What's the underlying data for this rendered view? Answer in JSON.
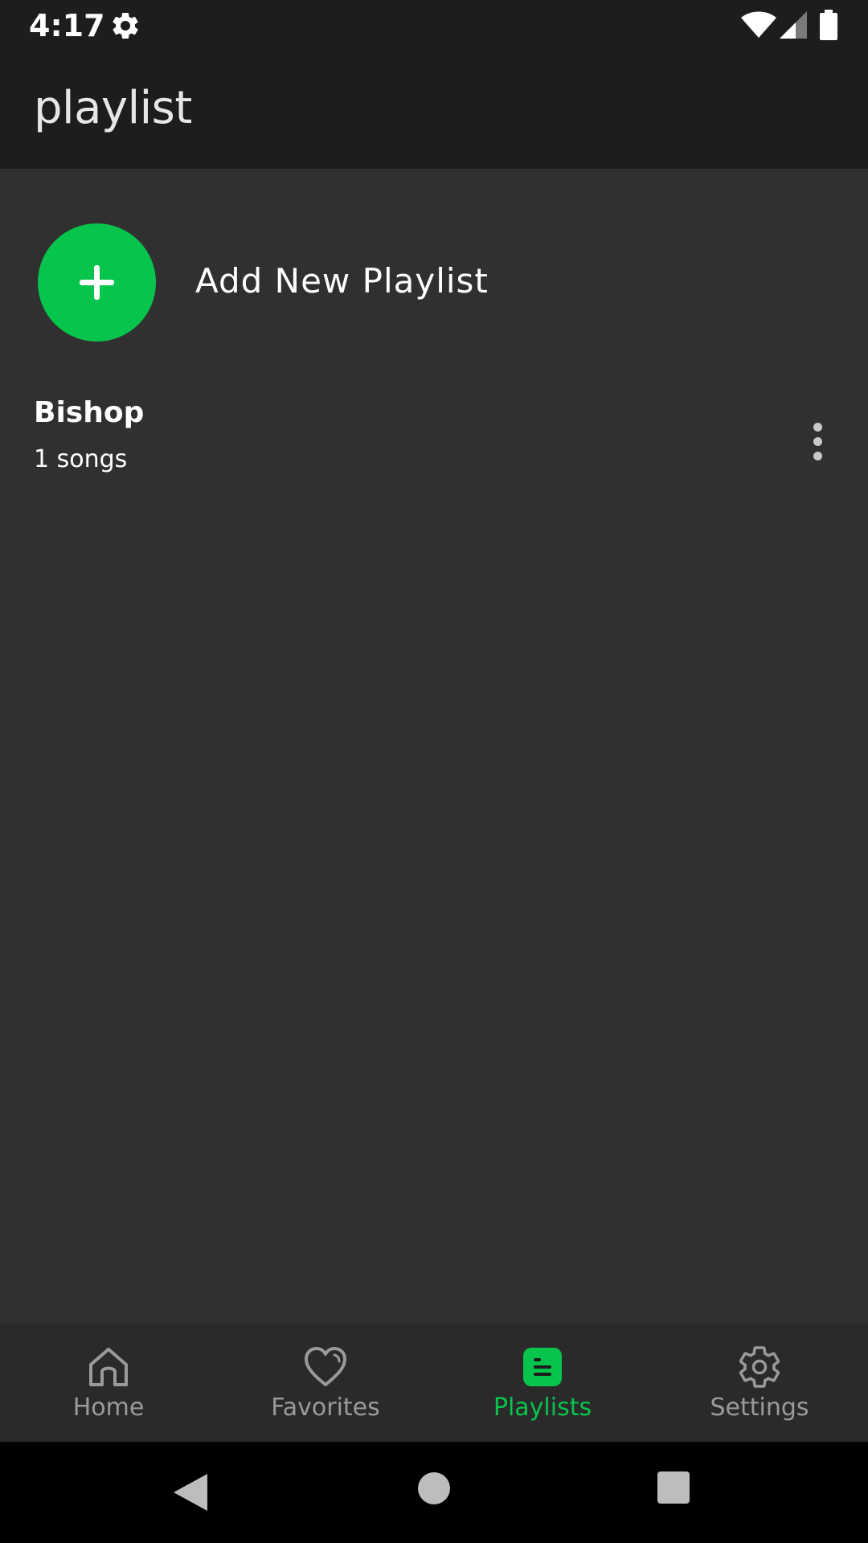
{
  "status_bar": {
    "time": "4:17",
    "icons": [
      "gear-icon",
      "wifi-icon",
      "signal-icon",
      "battery-icon"
    ]
  },
  "app_bar": {
    "title": "playlist"
  },
  "add_playlist": {
    "label": "Add New Playlist",
    "icon": "plus-icon",
    "accent_color": "#07c44d"
  },
  "playlists": [
    {
      "name": "Bishop",
      "count": "1 songs"
    }
  ],
  "bottom_nav": {
    "items": [
      {
        "label": "Home",
        "icon": "home-icon",
        "active": false
      },
      {
        "label": "Favorites",
        "icon": "heart-icon",
        "active": false
      },
      {
        "label": "Playlists",
        "icon": "playlist-icon",
        "active": true
      },
      {
        "label": "Settings",
        "icon": "gear-icon",
        "active": false
      }
    ],
    "active_color": "#07c44d",
    "inactive_color": "#9a9a9a"
  },
  "system_nav": {
    "icons": [
      "back-icon",
      "home-circle-icon",
      "recents-icon"
    ]
  }
}
